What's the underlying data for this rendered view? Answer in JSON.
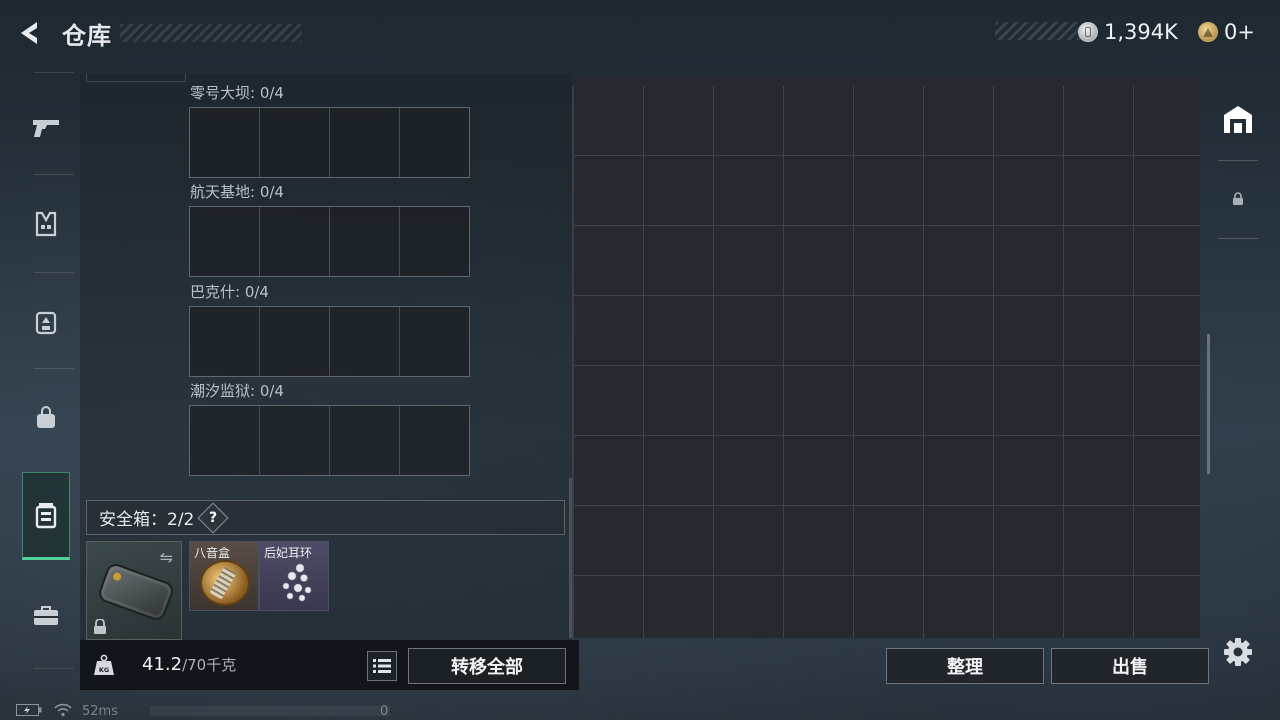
{
  "header": {
    "title": "仓库",
    "silver_amount": "1,394K",
    "gold_amount": "0+"
  },
  "nav": {
    "items": [
      "weapon",
      "armor",
      "backpack",
      "bag",
      "safe-box",
      "toolbox"
    ],
    "active": "safe-box"
  },
  "containers": {
    "regions": [
      {
        "label": "零号大坝: 0/4"
      },
      {
        "label": "航天基地: 0/4"
      },
      {
        "label": "巴克什: 0/4"
      },
      {
        "label": "潮汐监狱: 0/4"
      }
    ],
    "safe_box": {
      "label": "安全箱：2/2",
      "help": "?"
    },
    "items": [
      {
        "name": "八音盒"
      },
      {
        "name": "后妃耳环"
      }
    ]
  },
  "bottom": {
    "weight_value": "41.2",
    "weight_max": "/70千克",
    "weight_icon_text": "KG",
    "transfer_all": "转移全部",
    "sort": "整理",
    "sell": "出售"
  },
  "status": {
    "ping": "52ms",
    "counter": "0"
  },
  "colors": {
    "accent": "#4fd39a",
    "panel": "#262a2e"
  }
}
